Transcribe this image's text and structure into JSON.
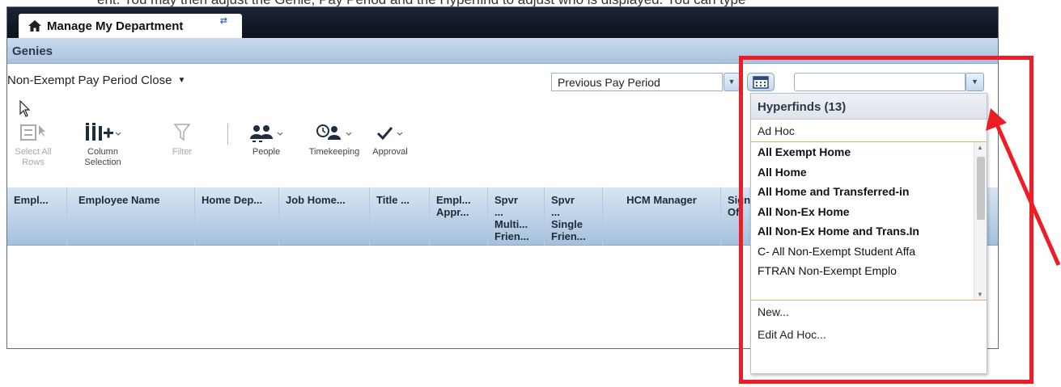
{
  "top_caption": "ent. You may then adjust the Genie, Pay Period and the Hyperfind to adjust who is displayed. You can type",
  "tab": {
    "title": "Manage My Department"
  },
  "genies_bar": {
    "title": "Genies"
  },
  "genie_selector": {
    "value": "Non-Exempt Pay Period Close"
  },
  "period_select": {
    "value": "Previous Pay Period"
  },
  "hyperfind_input": {
    "value": ""
  },
  "toolbar": {
    "select_all": "Select All Rows",
    "column_selection": "Column Selection",
    "filter": "Filter",
    "people": "People",
    "timekeeping": "Timekeeping",
    "approval": "Approval"
  },
  "grid": {
    "columns": [
      "Empl...",
      "Employee Name",
      "Home Dep...",
      "Job Home...",
      "Title ...",
      "Empl... Appr...",
      "Spvr ... Multi... Frien...",
      "Spvr ... Single Frien...",
      "HCM Manager",
      "Sign Of"
    ]
  },
  "hyperfinds": {
    "header": "Hyperfinds (13)",
    "ad_hoc": "Ad Hoc",
    "items": [
      {
        "label": "All Exempt Home",
        "bold": true
      },
      {
        "label": "All Home",
        "bold": true
      },
      {
        "label": "All Home and Transferred-in",
        "bold": true
      },
      {
        "label": "All Non-Ex Home",
        "bold": true
      },
      {
        "label": "All Non-Ex Home and Trans.In",
        "bold": true
      },
      {
        "label": "C- All Non-Exempt Student Affa",
        "bold": false
      },
      {
        "label": "FTRAN Non-Exempt Emplo",
        "bold": false
      }
    ],
    "footer": [
      "New...",
      "Edit Ad Hoc..."
    ]
  },
  "colors": {
    "annotation": "#ee1c24",
    "tabbar": "#0c121c",
    "header_blue": "#aac3de",
    "separator_orange": "#f0b24c"
  }
}
